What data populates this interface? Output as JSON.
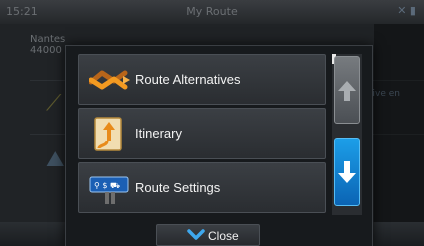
{
  "statusbar": {
    "time": "15:21",
    "title": "My Route"
  },
  "background": {
    "destination_city": "Nantes",
    "destination_zip": "44000",
    "alt_route_text": "ative en"
  },
  "menu": {
    "items": [
      {
        "label": "Route Alternatives",
        "icon": "route-alternatives-icon"
      },
      {
        "label": "Itinerary",
        "icon": "itinerary-icon"
      },
      {
        "label": "Route Settings",
        "icon": "route-settings-icon"
      }
    ],
    "close_label": "Close"
  },
  "colors": {
    "accent_blue": "#1c9ee8",
    "icon_orange": "#f39a21"
  }
}
